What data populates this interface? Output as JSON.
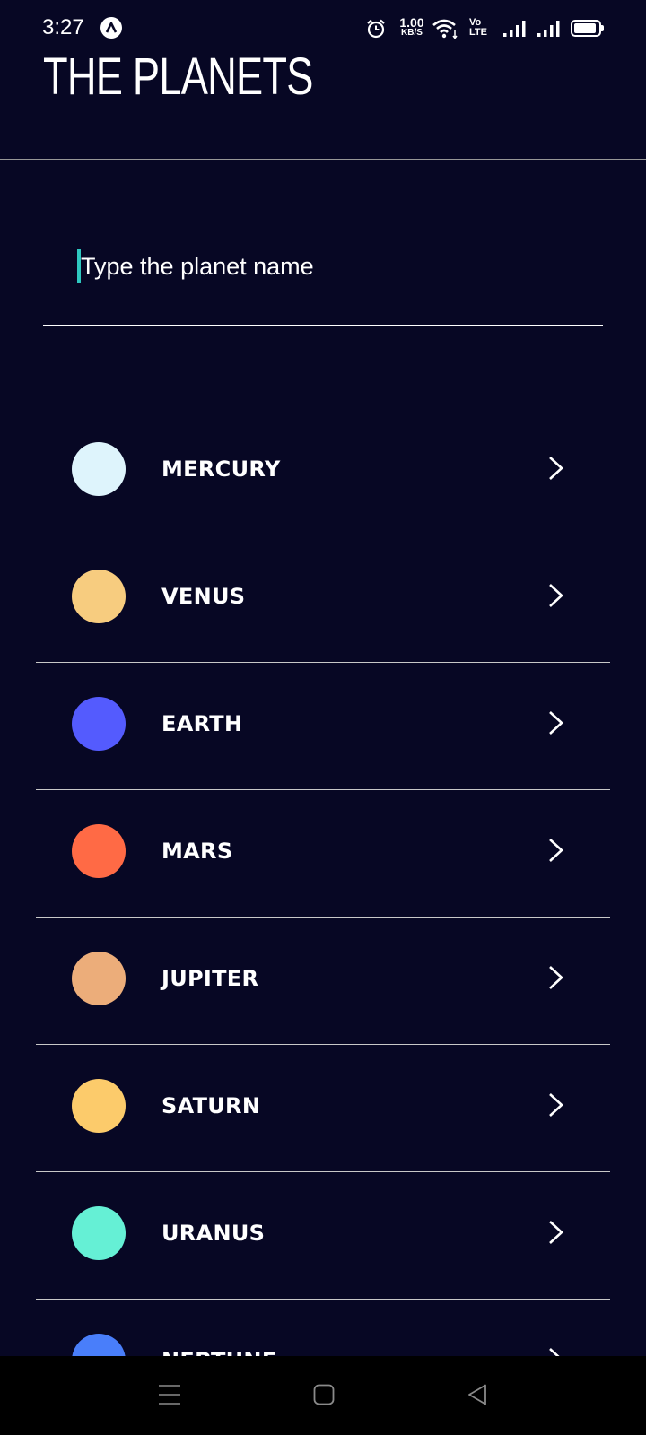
{
  "status_bar": {
    "time": "3:27",
    "net_speed_value": "1.00",
    "net_speed_unit": "KB/S",
    "volte_top": "Vo",
    "volte_bottom": "LTE"
  },
  "header": {
    "title": "THE PLANETS"
  },
  "search": {
    "placeholder": "Type the planet name",
    "value": ""
  },
  "planets": [
    {
      "name": "MERCURY",
      "color": "#DEF4FC"
    },
    {
      "name": "VENUS",
      "color": "#F7CC7F"
    },
    {
      "name": "EARTH",
      "color": "#545BFE"
    },
    {
      "name": "MARS",
      "color": "#FF6A45"
    },
    {
      "name": "JUPITER",
      "color": "#ECAD7A"
    },
    {
      "name": "SATURN",
      "color": "#FCCB6B"
    },
    {
      "name": "URANUS",
      "color": "#65F0D5"
    },
    {
      "name": "NEPTUNE",
      "color": "#497EFA"
    }
  ],
  "icons": {
    "row_action": "chevron-right-icon",
    "nav": [
      "menu-icon",
      "home-icon",
      "back-icon"
    ]
  },
  "colors": {
    "background": "#070724",
    "divider": "#979797",
    "cursor": "#2EC8C0"
  }
}
